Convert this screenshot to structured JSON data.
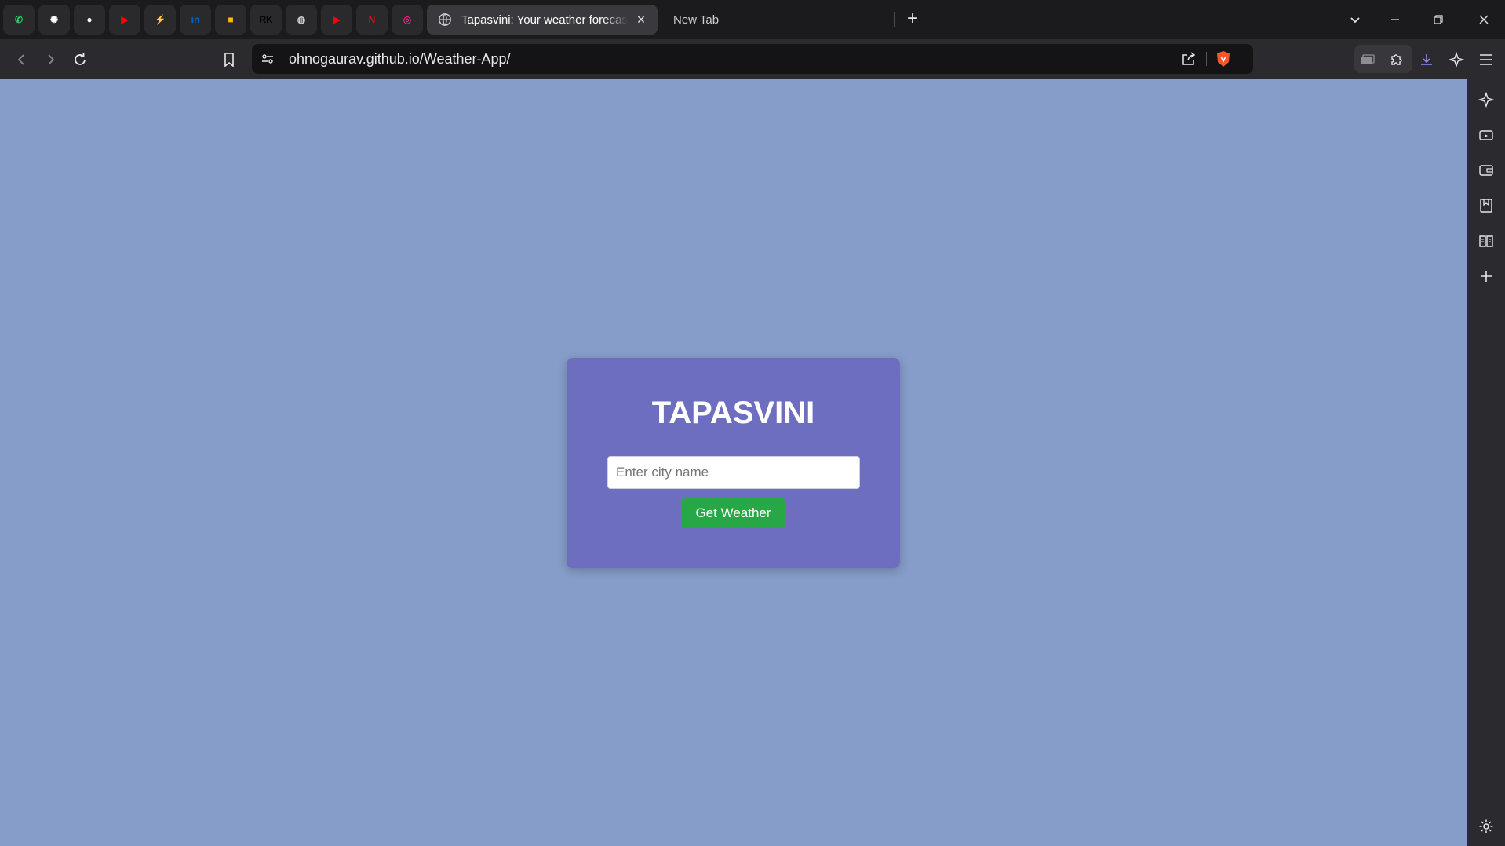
{
  "browser": {
    "pinned_tabs": [
      {
        "name": "whatsapp",
        "glyph": "✆",
        "color": "#25d366"
      },
      {
        "name": "chatgpt",
        "glyph": "✺",
        "color": "#ffffff"
      },
      {
        "name": "github",
        "glyph": "●",
        "color": "#ffffff"
      },
      {
        "name": "youtube",
        "glyph": "▶",
        "color": "#ff0000"
      },
      {
        "name": "bolt",
        "glyph": "⚡",
        "color": "#ff9900"
      },
      {
        "name": "linkedin",
        "glyph": "in",
        "color": "#0a66c2"
      },
      {
        "name": "keep",
        "glyph": "■",
        "color": "#fbbc04"
      },
      {
        "name": "rk",
        "glyph": "RK",
        "color": "#000000"
      },
      {
        "name": "globe",
        "glyph": "◍",
        "color": "#cccccc"
      },
      {
        "name": "youtube-2",
        "glyph": "▶",
        "color": "#ff0000"
      },
      {
        "name": "netflix",
        "glyph": "N",
        "color": "#e50914"
      },
      {
        "name": "instagram",
        "glyph": "◎",
        "color": "#d62976"
      }
    ],
    "active_tab": {
      "title": "Tapasvini: Your weather forecast",
      "icon": "globe-icon"
    },
    "inactive_tab": {
      "title": "New Tab"
    },
    "url": "ohnogaurav.github.io/Weather-App/"
  },
  "app": {
    "title": "TAPASVINI",
    "city_placeholder": "Enter city name",
    "city_value": "",
    "button_label": "Get Weather"
  },
  "colors": {
    "page_background": "#859dc8",
    "card_background": "#6e6ec0",
    "button_green": "#27a745",
    "brave_orange": "#fb542b"
  }
}
